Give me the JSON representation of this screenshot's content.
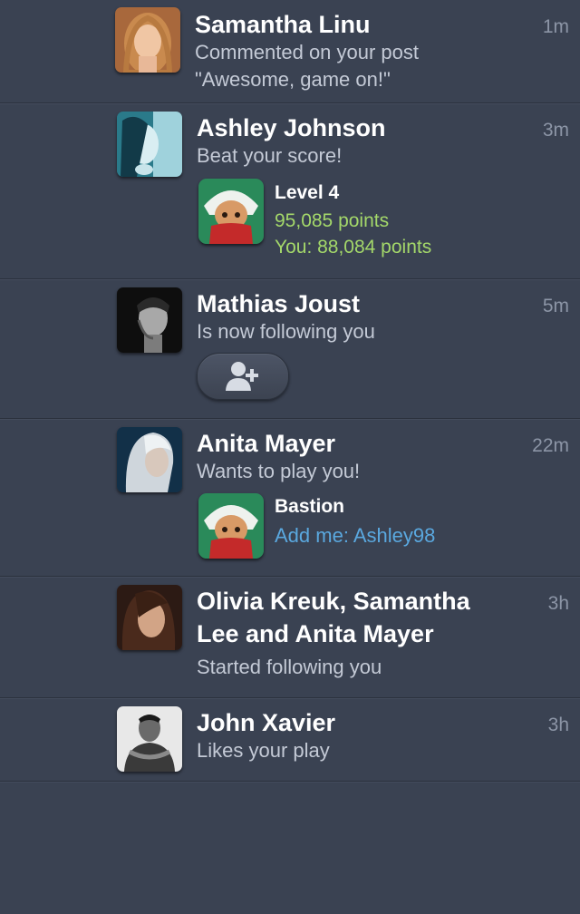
{
  "notifications": [
    {
      "name": "Samantha Linu",
      "description": "Commented on your post",
      "description2": "\"Awesome, game on!\"",
      "time": "1m"
    },
    {
      "name": "Ashley Johnson",
      "description": "Beat your score!",
      "time": "3m",
      "game": {
        "title": "Level 4",
        "line1": "95,085 points",
        "line2": "You: 88,084 points"
      }
    },
    {
      "name": "Mathias Joust",
      "description": "Is now following you",
      "time": "5m",
      "action_icon": "add-friend-icon"
    },
    {
      "name": "Anita Mayer",
      "description": "Wants to play you!",
      "time": "22m",
      "game": {
        "title": "Bastion",
        "line1": "Add me: Ashley98"
      }
    },
    {
      "name_line1": "Olivia Kreuk, Samantha",
      "name_line2": "Lee and Anita Mayer",
      "description": "Started following you",
      "time": "3h"
    },
    {
      "name": "John Xavier",
      "description": "Likes your play",
      "time": "3h"
    }
  ],
  "colors": {
    "background": "#3a4252",
    "score_green": "#a4d86a",
    "link_blue": "#5aa8df",
    "secondary_text": "#c4cad6",
    "timestamp": "#8c95a6"
  }
}
